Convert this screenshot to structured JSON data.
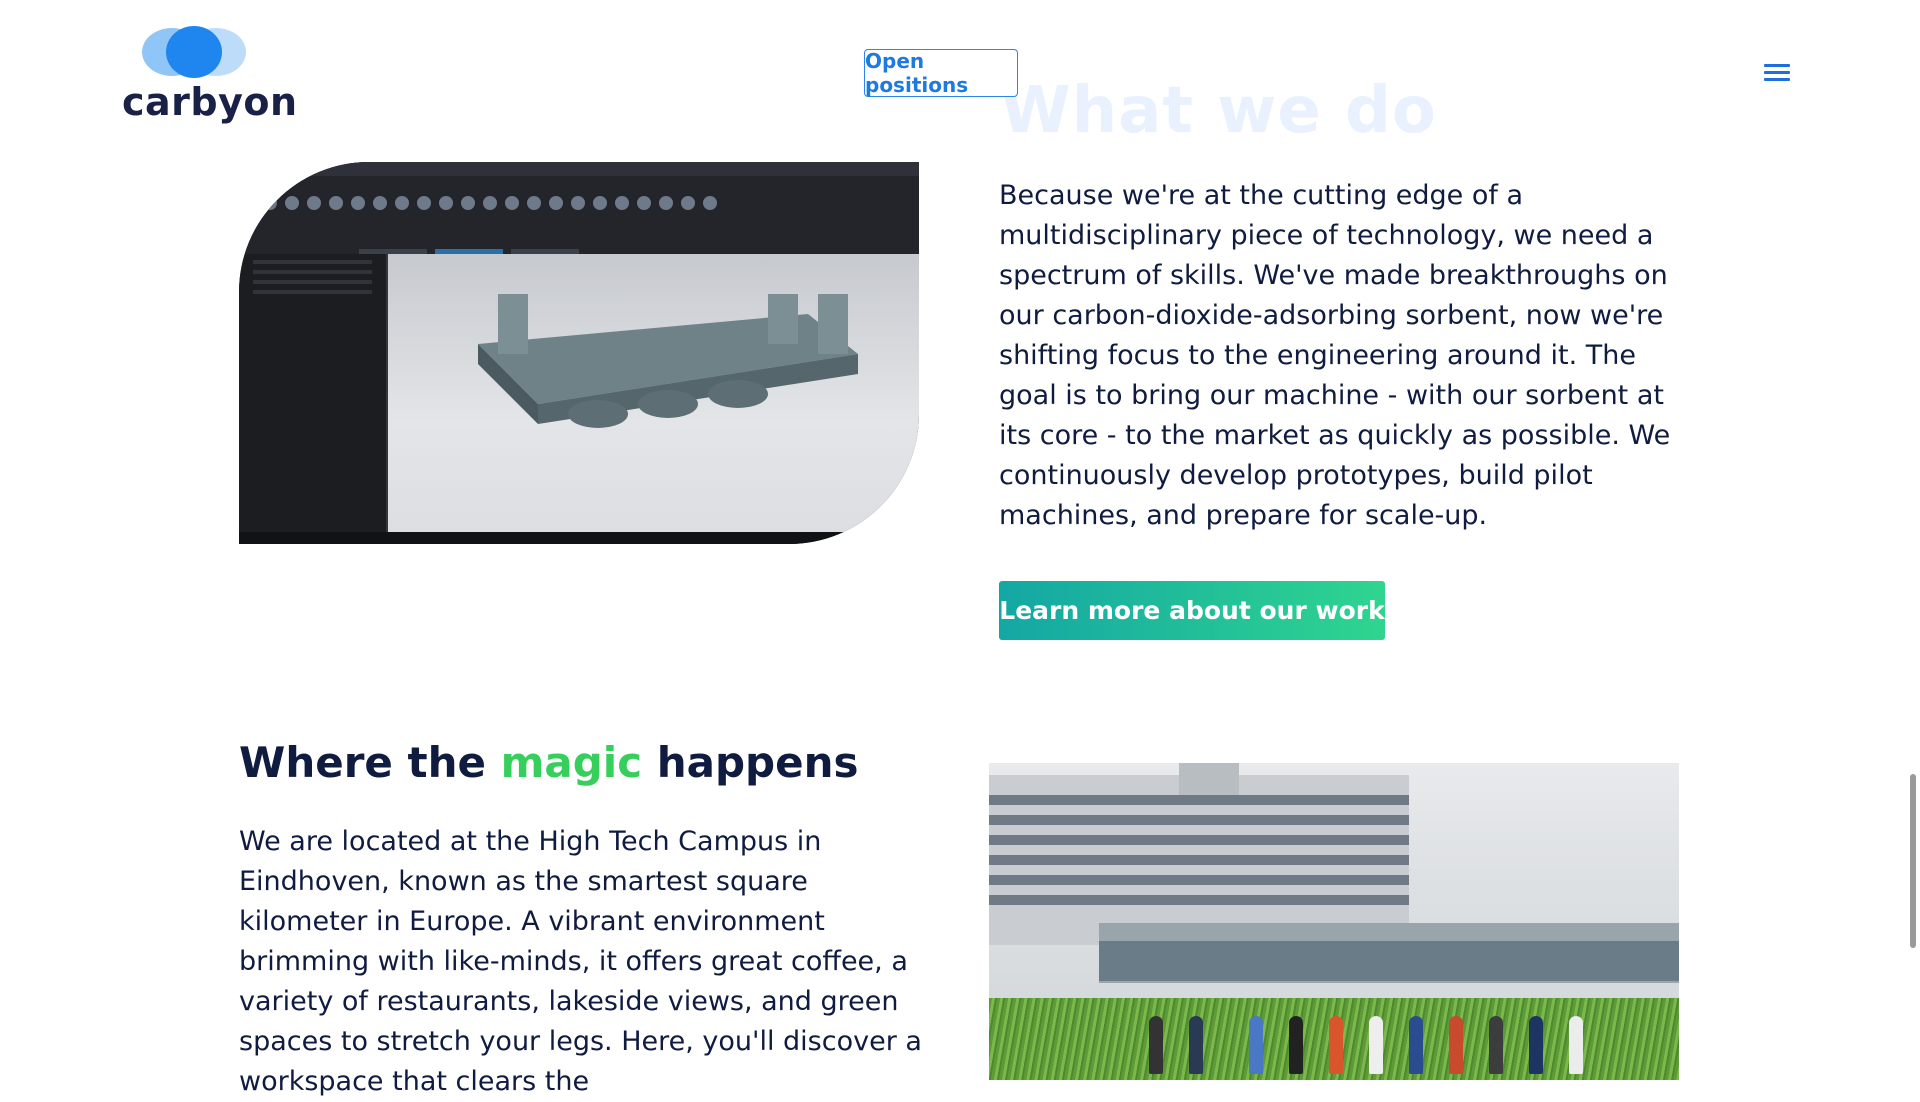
{
  "header": {
    "logo_text": "carbyon",
    "open_positions_label": "Open positions",
    "menu_icon": "hamburger-menu-icon"
  },
  "what_we_do": {
    "title": "What we do",
    "body": "Because we're at the cutting edge of a multidisciplinary piece of technology, we need a spectrum of skills. We've made breakthroughs on our carbon-dioxide-adsorbing sorbent, now we're shifting focus to the engineering around it. The goal is to bring our machine - with our sorbent at its core - to the market as quickly as possible. We continuously develop prototypes, build pilot machines, and prepare for scale-up.",
    "cta_label": "Learn more about our work"
  },
  "location": {
    "title_before": "Where the ",
    "title_accent": "magic",
    "title_after": " happens",
    "body": "We are located at the High Tech Campus in Eindhoven, known as the smartest square kilometer in Europe. A vibrant environment brimming with like-minds, it offers great coffee, a variety of restaurants, lakeside views, and green spaces to stretch your legs. Here, you'll discover a workspace that clears the"
  },
  "colors": {
    "brand_blue": "#1f86ef",
    "navy_text": "#101b40",
    "accent_green": "#36cf5c",
    "cta_gradient_start": "#14a7a4",
    "cta_gradient_end": "#2fd58f"
  }
}
